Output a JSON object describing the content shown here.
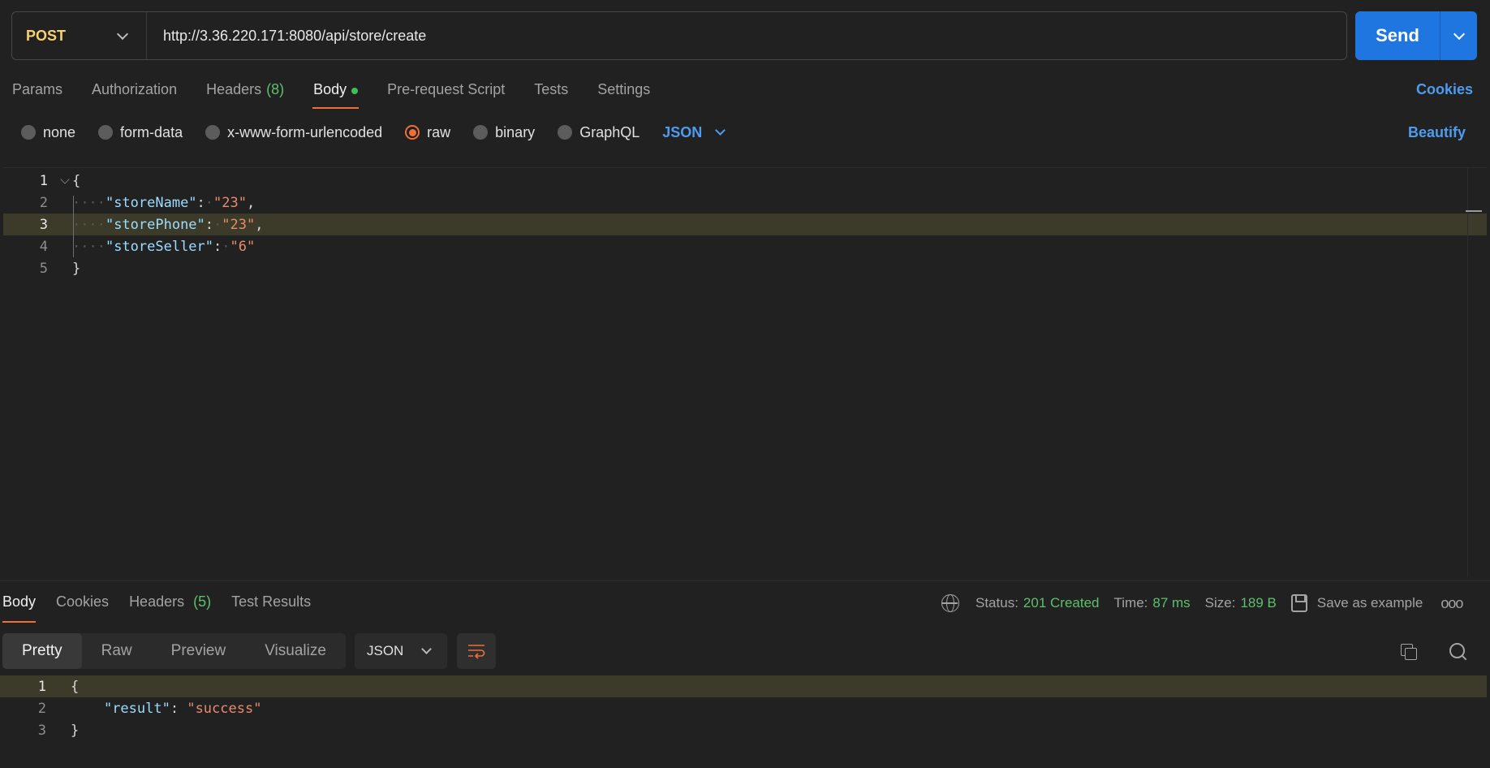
{
  "request": {
    "method": "POST",
    "url": "http://3.36.220.171:8080/api/store/create",
    "send_label": "Send"
  },
  "request_tabs": [
    {
      "label": "Params"
    },
    {
      "label": "Authorization"
    },
    {
      "label": "Headers",
      "count": "(8)"
    },
    {
      "label": "Body",
      "active": true
    },
    {
      "label": "Pre-request Script"
    },
    {
      "label": "Tests"
    },
    {
      "label": "Settings"
    }
  ],
  "cookies_label": "Cookies",
  "body_types": [
    {
      "label": "none"
    },
    {
      "label": "form-data"
    },
    {
      "label": "x-www-form-urlencoded"
    },
    {
      "label": "raw",
      "selected": true
    },
    {
      "label": "binary"
    },
    {
      "label": "GraphQL"
    }
  ],
  "body_format": "JSON",
  "beautify_label": "Beautify",
  "request_body": [
    {
      "num": "1",
      "open": "{"
    },
    {
      "num": "2",
      "key": "\"storeName\"",
      "value": "\"23\"",
      "comma": ","
    },
    {
      "num": "3",
      "key": "\"storePhone\"",
      "value": "\"23\"",
      "comma": ","
    },
    {
      "num": "4",
      "key": "\"storeSeller\"",
      "value": "\"6\"",
      "comma": ""
    },
    {
      "num": "5",
      "close": "}"
    }
  ],
  "response_tabs": [
    {
      "label": "Body",
      "active": true
    },
    {
      "label": "Cookies"
    },
    {
      "label": "Headers",
      "count": "(5)"
    },
    {
      "label": "Test Results"
    }
  ],
  "response_meta": {
    "status_label": "Status:",
    "status_value": "201 Created",
    "time_label": "Time:",
    "time_value": "87 ms",
    "size_label": "Size:",
    "size_value": "189 B",
    "save_label": "Save as example",
    "more": "ooo"
  },
  "view_modes": [
    "Pretty",
    "Raw",
    "Preview",
    "Visualize"
  ],
  "response_format": "JSON",
  "response_body": [
    {
      "num": "1",
      "text": "{"
    },
    {
      "num": "2",
      "key": "\"result\"",
      "value": "\"success\""
    },
    {
      "num": "3",
      "text": "}"
    }
  ],
  "colors": {
    "accent": "#ee6f3a",
    "primary": "#1f76e0",
    "link": "#4d9cf0",
    "success": "#5cc06b",
    "method_post": "#f7d070"
  }
}
